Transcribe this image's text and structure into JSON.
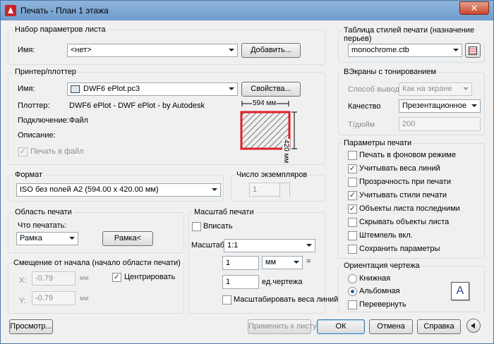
{
  "window": {
    "title": "Печать - План 1 этажа",
    "close": "✕"
  },
  "page_setup": {
    "group": "Набор параметров листа",
    "name_label": "Имя:",
    "name_value": "<нет>",
    "add_button": "Добавить..."
  },
  "printer": {
    "group": "Принтер/плоттер",
    "name_label": "Имя:",
    "name_value": "DWF6 ePlot.pc3",
    "properties_button": "Свойства...",
    "plotter_label": "Плоттер:",
    "plotter_value": "DWF6 ePlot - DWF ePlot - by Autodesk",
    "connection_label": "Подключение:",
    "connection_value": "Файл",
    "description_label": "Описание:",
    "print_to_file": "Печать в файл",
    "preview_width": "594 мм",
    "preview_height": "420 мм"
  },
  "format": {
    "group": "Формат",
    "value": "ISO без полей A2 (594.00 x 420.00 мм)"
  },
  "copies": {
    "group": "Число экземпляров",
    "value": "1"
  },
  "area": {
    "group": "Область печати",
    "what_label": "Что печатать:",
    "what_value": "Рамка",
    "frame_button": "Рамка<"
  },
  "offset": {
    "group": "Смещение от начала (начало области печати)",
    "x_label": "X:",
    "x_value": "-0.79",
    "x_unit": "мм",
    "y_label": "Y:",
    "y_value": "-0.79",
    "y_unit": "мм",
    "center_label": "Центрировать"
  },
  "scale": {
    "group": "Масштаб печати",
    "fit_label": "Вписать",
    "scale_label": "Масштаб:",
    "scale_value": "1:1",
    "value1": "1",
    "unit_value": "мм",
    "equals": "=",
    "value2": "1",
    "unit2_label": "ед.чертежа",
    "lineweights_label": "Масштабировать веса линий"
  },
  "styles": {
    "group": "Таблица стилей печати (назначение перьев)",
    "value": "monochrome.ctb"
  },
  "shaded": {
    "group": "ВЭкраны с тонированием",
    "method_label": "Способ вывода",
    "method_value": "Как на экране",
    "quality_label": "Качество",
    "quality_value": "Презентационное",
    "dpi_label": "Т/дюйм",
    "dpi_value": "200"
  },
  "options": {
    "group": "Параметры печати",
    "items": [
      {
        "label": "Печать в фоновом режиме",
        "checked": false
      },
      {
        "label": "Учитывать веса линий",
        "checked": true
      },
      {
        "label": "Прозрачность при печати",
        "checked": false
      },
      {
        "label": "Учитывать стили печати",
        "checked": true
      },
      {
        "label": "Объекты листа последними",
        "checked": true
      },
      {
        "label": "Скрывать объекты листа",
        "checked": false
      },
      {
        "label": "Штемпель вкл.",
        "checked": false
      },
      {
        "label": "Сохранить параметры",
        "checked": false
      }
    ]
  },
  "orientation": {
    "group": "Ориентация чертежа",
    "portrait": "Книжная",
    "landscape": "Альбомная",
    "flip": "Перевернуть",
    "icon_letter": "A"
  },
  "buttons": {
    "preview": "Просмотр...",
    "apply": "Применить к листу",
    "ok": "ОК",
    "cancel": "Отмена",
    "help": "Справка"
  },
  "colors": {
    "accent": "#3c7fb1",
    "preview_red": "#e0202a",
    "titlebar": "#7aa6d3"
  }
}
